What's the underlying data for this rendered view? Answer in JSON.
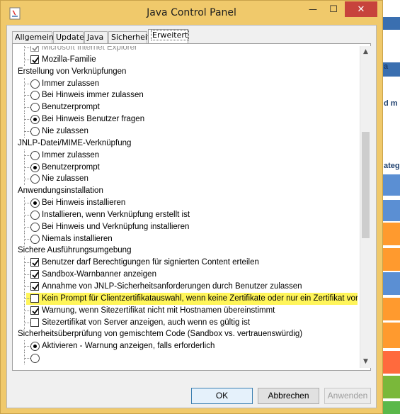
{
  "window": {
    "title": "Java Control Panel",
    "minimize_glyph": "—",
    "maximize_glyph": "☐",
    "close_glyph": "✕"
  },
  "tabs": [
    {
      "label": "Allgemein",
      "active": false
    },
    {
      "label": "Update",
      "active": false
    },
    {
      "label": "Java",
      "active": false
    },
    {
      "label": "Sicherheit",
      "active": false
    },
    {
      "label": "Erweitert",
      "active": true
    }
  ],
  "settings": [
    {
      "type": "checkbox",
      "label": "Microsoft Internet Explorer",
      "checked": true,
      "disabled": true,
      "level": 1
    },
    {
      "type": "checkbox",
      "label": "Mozilla-Familie",
      "checked": true,
      "level": 1
    },
    {
      "type": "group",
      "label": "Erstellung von Verknüpfungen"
    },
    {
      "type": "radio",
      "label": "Immer zulassen",
      "checked": false,
      "level": 1
    },
    {
      "type": "radio",
      "label": "Bei Hinweis immer zulassen",
      "checked": false,
      "level": 1
    },
    {
      "type": "radio",
      "label": "Benutzerprompt",
      "checked": false,
      "level": 1
    },
    {
      "type": "radio",
      "label": "Bei Hinweis Benutzer fragen",
      "checked": true,
      "level": 1
    },
    {
      "type": "radio",
      "label": "Nie zulassen",
      "checked": false,
      "level": 1
    },
    {
      "type": "group",
      "label": "JNLP-Datei/MIME-Verknüpfung"
    },
    {
      "type": "radio",
      "label": "Immer zulassen",
      "checked": false,
      "level": 1
    },
    {
      "type": "radio",
      "label": "Benutzerprompt",
      "checked": true,
      "level": 1
    },
    {
      "type": "radio",
      "label": "Nie zulassen",
      "checked": false,
      "level": 1
    },
    {
      "type": "group",
      "label": "Anwendungsinstallation"
    },
    {
      "type": "radio",
      "label": "Bei Hinweis installieren",
      "checked": true,
      "level": 1
    },
    {
      "type": "radio",
      "label": "Installieren, wenn Verknüpfung erstellt ist",
      "checked": false,
      "level": 1
    },
    {
      "type": "radio",
      "label": "Bei Hinweis und Verknüpfung installieren",
      "checked": false,
      "level": 1
    },
    {
      "type": "radio",
      "label": "Niemals installieren",
      "checked": false,
      "level": 1
    },
    {
      "type": "group",
      "label": "Sichere Ausführungsumgebung"
    },
    {
      "type": "checkbox",
      "label": "Benutzer darf Berechtigungen für signierten Content erteilen",
      "checked": true,
      "level": 1
    },
    {
      "type": "checkbox",
      "label": "Sandbox-Warnbanner anzeigen",
      "checked": true,
      "level": 1
    },
    {
      "type": "checkbox",
      "label": "Annahme von JNLP-Sicherheitsanforderungen durch Benutzer zulassen",
      "checked": true,
      "level": 1
    },
    {
      "type": "checkbox",
      "label": "Kein Prompt für Clientzertifikatauswahl, wenn keine Zertifikate oder nur ein Zertifikat vorhand",
      "checked": false,
      "level": 1,
      "highlighted": true
    },
    {
      "type": "checkbox",
      "label": "Warnung, wenn Sitezertifikat nicht mit Hostnamen übereinstimmt",
      "checked": true,
      "level": 1
    },
    {
      "type": "checkbox",
      "label": "Sitezertifikat von Server anzeigen, auch wenn es gültig ist",
      "checked": false,
      "level": 1
    },
    {
      "type": "group",
      "label": "Sicherheitsüberprüfung von gemischtem Code (Sandbox vs. vertrauenswürdig)"
    },
    {
      "type": "radio",
      "label": "Aktivieren - Warnung anzeigen, falls erforderlich",
      "checked": true,
      "level": 1
    },
    {
      "type": "radio",
      "label": "",
      "checked": false,
      "level": 1
    }
  ],
  "scrollbar": {
    "up_glyph": "▲",
    "down_glyph": "▼"
  },
  "buttons": {
    "ok": "OK",
    "cancel": "Abbrechen",
    "apply": "Anwenden"
  },
  "colors": {
    "title_bar": "#f0c96b",
    "close_button": "#c7433c",
    "highlight": "#fff55a"
  },
  "background_strip": {
    "fragments": [
      "a",
      "d m",
      "ateg"
    ],
    "blocks": [
      "#3a6fb0",
      "#ffffff",
      "#3a6fb0",
      "#ffffff",
      "#5b8fd3",
      "#5b8fd3",
      "#ff9a2e",
      "#ff9a2e",
      "#5b8fd3",
      "#ff9a2e",
      "#ff9a2e",
      "#ff6a3d",
      "#7ab83a",
      "#5ab84a"
    ]
  }
}
